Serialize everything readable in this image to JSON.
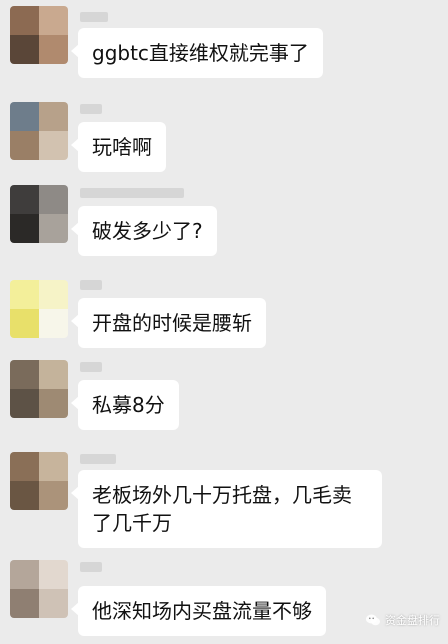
{
  "messages": [
    {
      "text": "ggbtc直接维权就完事了",
      "avatar_colors": [
        "#8c6a52",
        "#c9a98f",
        "#5a4638",
        "#b08a6e"
      ]
    },
    {
      "text": "玩啥啊",
      "avatar_colors": [
        "#6e7d8b",
        "#b7a18a",
        "#9a7f66",
        "#d2c2b0"
      ]
    },
    {
      "text": "破发多少了?",
      "avatar_colors": [
        "#3f3d3c",
        "#8e8a86",
        "#2b2927",
        "#a8a29b"
      ]
    },
    {
      "text": "开盘的时候是腰斩",
      "avatar_colors": [
        "#f3ef9a",
        "#f6f3c7",
        "#e8e06a",
        "#f7f6ea"
      ]
    },
    {
      "text": "私募8分",
      "avatar_colors": [
        "#7a6b5b",
        "#c4b39b",
        "#5d5246",
        "#9e8a73"
      ]
    },
    {
      "text": "老板场外几十万托盘，几毛卖了几千万",
      "avatar_colors": [
        "#8a6f57",
        "#c7b49c",
        "#6a5643",
        "#ab937a"
      ]
    },
    {
      "text": "他深知场内买盘流量不够",
      "avatar_colors": [
        "#b4a69a",
        "#e2d8cf",
        "#8f7f72",
        "#cfc2b6"
      ]
    }
  ],
  "watermark": {
    "text": "资金盘排行",
    "icon": "wechat-icon"
  }
}
